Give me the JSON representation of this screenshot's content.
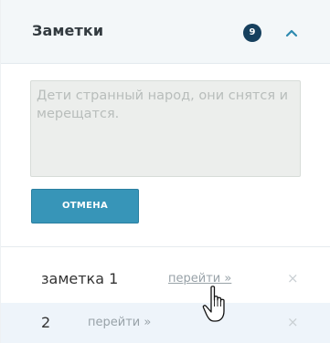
{
  "header": {
    "title": "Заметки",
    "count": "9"
  },
  "editor": {
    "placeholder": "Дети странный народ, они снятся и мерещатся.",
    "value": ""
  },
  "actions": {
    "cancel_label": "ОТМЕНА"
  },
  "notes": [
    {
      "title": "заметка 1",
      "link_label": "перейти »",
      "close_label": "×"
    },
    {
      "title": "2",
      "link_label": "перейти »",
      "close_label": "×"
    }
  ],
  "colors": {
    "header_bg": "#f3f7f9",
    "badge": "#16405e",
    "accent": "#3795b8",
    "chevron": "#2e8ab0",
    "row_highlight": "#eef4fa"
  },
  "icons": {
    "collapse": "chevron-up-icon",
    "close": "close-icon",
    "pointer": "hand-pointer-icon"
  }
}
